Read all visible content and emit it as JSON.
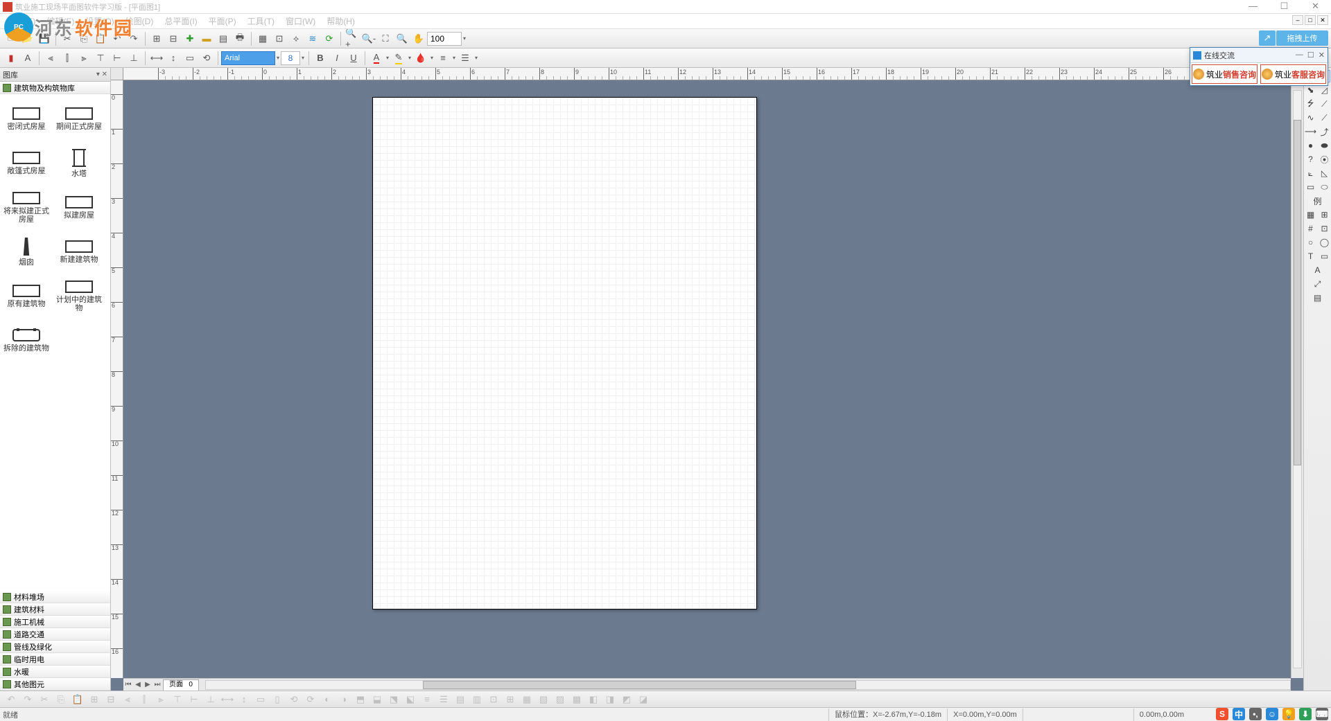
{
  "app": {
    "title": "筑业施工现场平面图软件学习版 - [平面图1]",
    "doc_controls": [
      "–",
      "□",
      "✕"
    ]
  },
  "window": {
    "min": "—",
    "max": "☐",
    "close": "✕"
  },
  "menu": [
    {
      "label": "文件(F)"
    },
    {
      "label": "编辑(E)"
    },
    {
      "label": "设置(O)"
    },
    {
      "label": "绘图(D)"
    },
    {
      "label": "总平面(I)"
    },
    {
      "label": "平面(P)"
    },
    {
      "label": "工具(T)"
    },
    {
      "label": "窗口(W)"
    },
    {
      "label": "帮助(H)"
    }
  ],
  "toolbar1": {
    "zoom": "100"
  },
  "toolbar2": {
    "font": "Arial",
    "size": "8",
    "bold": "B",
    "italic": "I",
    "underline": "U"
  },
  "upload": {
    "icon": "↗",
    "label": "拖拽上传"
  },
  "chat": {
    "title": "在线交流",
    "btn1_prefix": "筑业",
    "btn1_bold": "销售咨询",
    "btn2_prefix": "筑业",
    "btn2_bold": "客服咨询"
  },
  "library": {
    "header": "图库",
    "active_category": "建筑物及构筑物库",
    "items": [
      {
        "label": "密闭式房屋",
        "sym": "rect"
      },
      {
        "label": "期间正式房屋",
        "sym": "rect"
      },
      {
        "label": "敞篷式房屋",
        "sym": "rect"
      },
      {
        "label": "水塔",
        "sym": "tower"
      },
      {
        "label": "将来拟建正式房屋",
        "sym": "rect"
      },
      {
        "label": "拟建房屋",
        "sym": "rect"
      },
      {
        "label": "烟囱",
        "sym": "chimney"
      },
      {
        "label": "新建建筑物",
        "sym": "rect"
      },
      {
        "label": "原有建筑物",
        "sym": "rect"
      },
      {
        "label": "计划中的建筑物",
        "sym": "rect"
      },
      {
        "label": "拆除的建筑物",
        "sym": "bracket"
      }
    ],
    "categories": [
      "材料堆场",
      "建筑材料",
      "施工机械",
      "道路交通",
      "管线及绿化",
      "临时用电",
      "水暖",
      "其他图元"
    ]
  },
  "page_tabs": {
    "label": "页面",
    "num": "0"
  },
  "status": {
    "ready": "就绪",
    "mouse": "鼠标位置：X=-2.67m,Y=-0.18m",
    "origin": "X=0.00m,Y=0.00m",
    "dims": "0.00m,0.00m"
  },
  "watermark": {
    "logo": "PC",
    "gray": "河东",
    "orange": "软件园"
  },
  "tray": [
    {
      "c": "#f05030",
      "t": "S"
    },
    {
      "c": "#2a88d8",
      "t": "中"
    },
    {
      "c": "#666",
      "t": "•,"
    },
    {
      "c": "#2a88d8",
      "t": "☺"
    },
    {
      "c": "#f0a020",
      "t": "💡"
    },
    {
      "c": "#30a058",
      "t": "⬇"
    },
    {
      "c": "#666",
      "t": "⌨"
    }
  ],
  "side_tools": [
    [
      "↖"
    ],
    [
      "⬊",
      "◿"
    ],
    [
      "⭍",
      "⟋"
    ],
    [
      "∿",
      "⟋"
    ],
    [
      "⟶",
      "⤴"
    ],
    [
      "●",
      "⬬"
    ],
    [
      "?",
      "⦿"
    ],
    [
      "⟀",
      "◺"
    ],
    [
      "▭",
      "⬭"
    ],
    [
      "例",
      ""
    ],
    [
      "▦",
      "⊞"
    ],
    [
      "#",
      "⊡"
    ],
    [
      "○",
      "◯"
    ],
    [
      "T",
      "▭"
    ],
    [
      "A",
      ""
    ],
    [
      "⤢",
      ""
    ],
    [
      "▤",
      ""
    ]
  ]
}
